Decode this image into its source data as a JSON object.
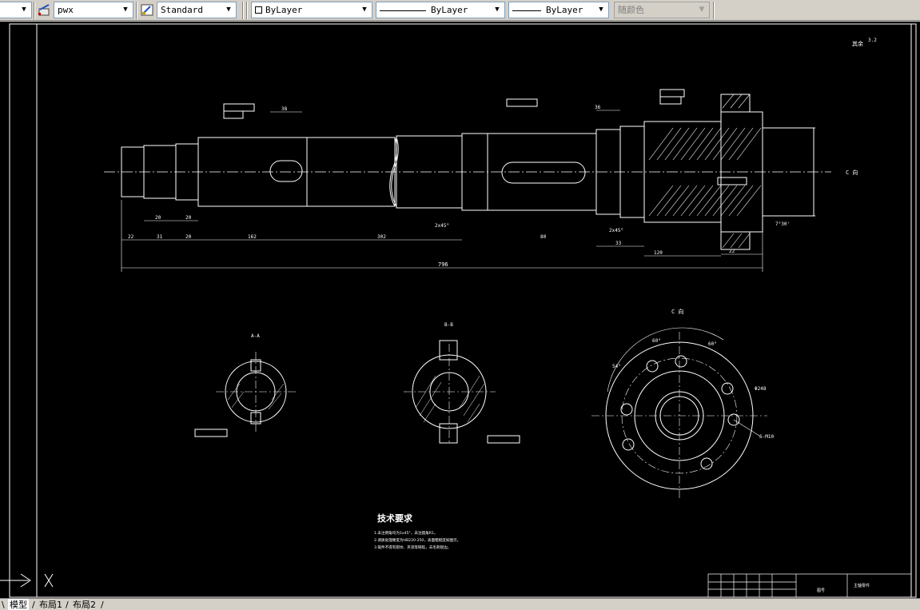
{
  "toolbar": {
    "layer_value": "pwx",
    "textstyle_value": "Standard",
    "color_value": "ByLayer",
    "linetype_value": "ByLayer",
    "lineweight_value": "ByLayer",
    "plotstyle_value": "随颜色"
  },
  "drawing": {
    "roughness_label": "其余",
    "roughness_value": "3.2",
    "section_A_label": "A-A",
    "section_B_label": "B-B",
    "view_C_label": "C 向",
    "view_C_arrow_label": "C 向",
    "tech_title": "技术要求",
    "tech_notes": [
      "1.未注倒角均为1x45°，未注圆角R1。",
      "2.调质处理硬度为HB220-250，表面粗糙度如图示。",
      "3.锻件不得有裂纹、夹渣等缺陷，去毛刺锐边。"
    ],
    "total_length": "796",
    "dims": {
      "d22": "22",
      "d31": "31",
      "d20a": "20",
      "d20b": "20",
      "d20c": "20",
      "d162": "162",
      "d302": "302",
      "d38": "38",
      "d33": "33",
      "d120": "120",
      "d22b": "22",
      "d36": "36",
      "d80": "80",
      "d2x45": "2x45°",
      "d2x45b": "2x45°",
      "d6holes": "6-M10",
      "dphi248": "Φ248",
      "dang1": "60°",
      "dang2": "60°",
      "dang3": "54°",
      "dang4": "7°30'"
    },
    "title_block_left": "图号",
    "title_block_right": "主轴零件"
  },
  "tabs": {
    "model": "模型",
    "layout1": "布局1",
    "layout2": "布局2"
  }
}
